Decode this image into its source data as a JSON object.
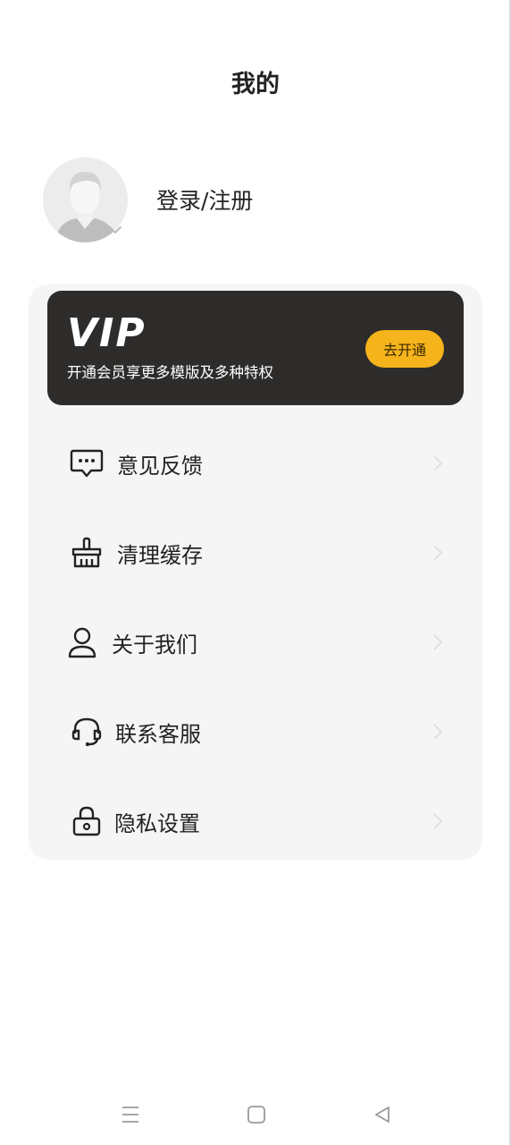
{
  "header": {
    "title": "我的"
  },
  "profile": {
    "login_label": "登录/注册"
  },
  "vip": {
    "logo": "VIP",
    "description": "开通会员享更多模版及多种特权",
    "button_label": "去开通"
  },
  "menu": {
    "items": [
      {
        "label": "意见反馈",
        "icon": "feedback-icon"
      },
      {
        "label": "清理缓存",
        "icon": "broom-icon"
      },
      {
        "label": "关于我们",
        "icon": "user-icon"
      },
      {
        "label": "联系客服",
        "icon": "headset-icon"
      },
      {
        "label": "隐私设置",
        "icon": "lock-icon"
      }
    ]
  },
  "colors": {
    "vip_bg": "#2e2c2b",
    "vip_button": "#f5b31c",
    "card_bg": "#f5f5f5"
  }
}
